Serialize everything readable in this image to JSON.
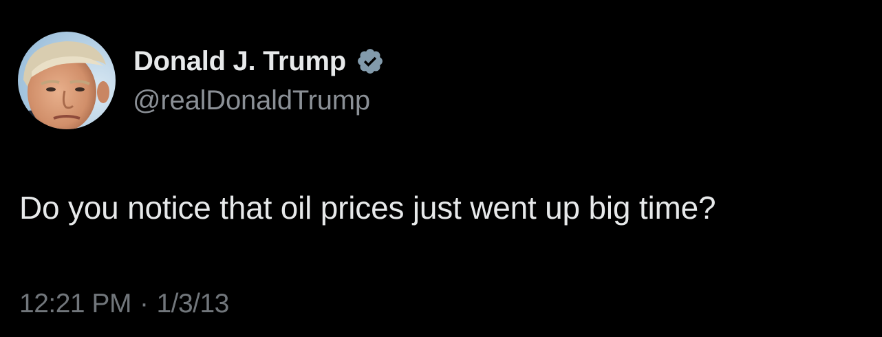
{
  "author": {
    "display_name": "Donald J. Trump",
    "handle": "@realDonaldTrump",
    "verified_badge_icon": "verified-badge-icon",
    "avatar": "profile-photo"
  },
  "tweet": {
    "text": "Do you notice that oil prices just went up big time?",
    "time": "12:21 PM",
    "separator": "·",
    "date": "1/3/13"
  },
  "colors": {
    "background": "#000000",
    "primary_text": "#e7e9ea",
    "secondary_text": "#8b9096",
    "meta_text": "#71767b",
    "verified_badge": "#829aab"
  }
}
